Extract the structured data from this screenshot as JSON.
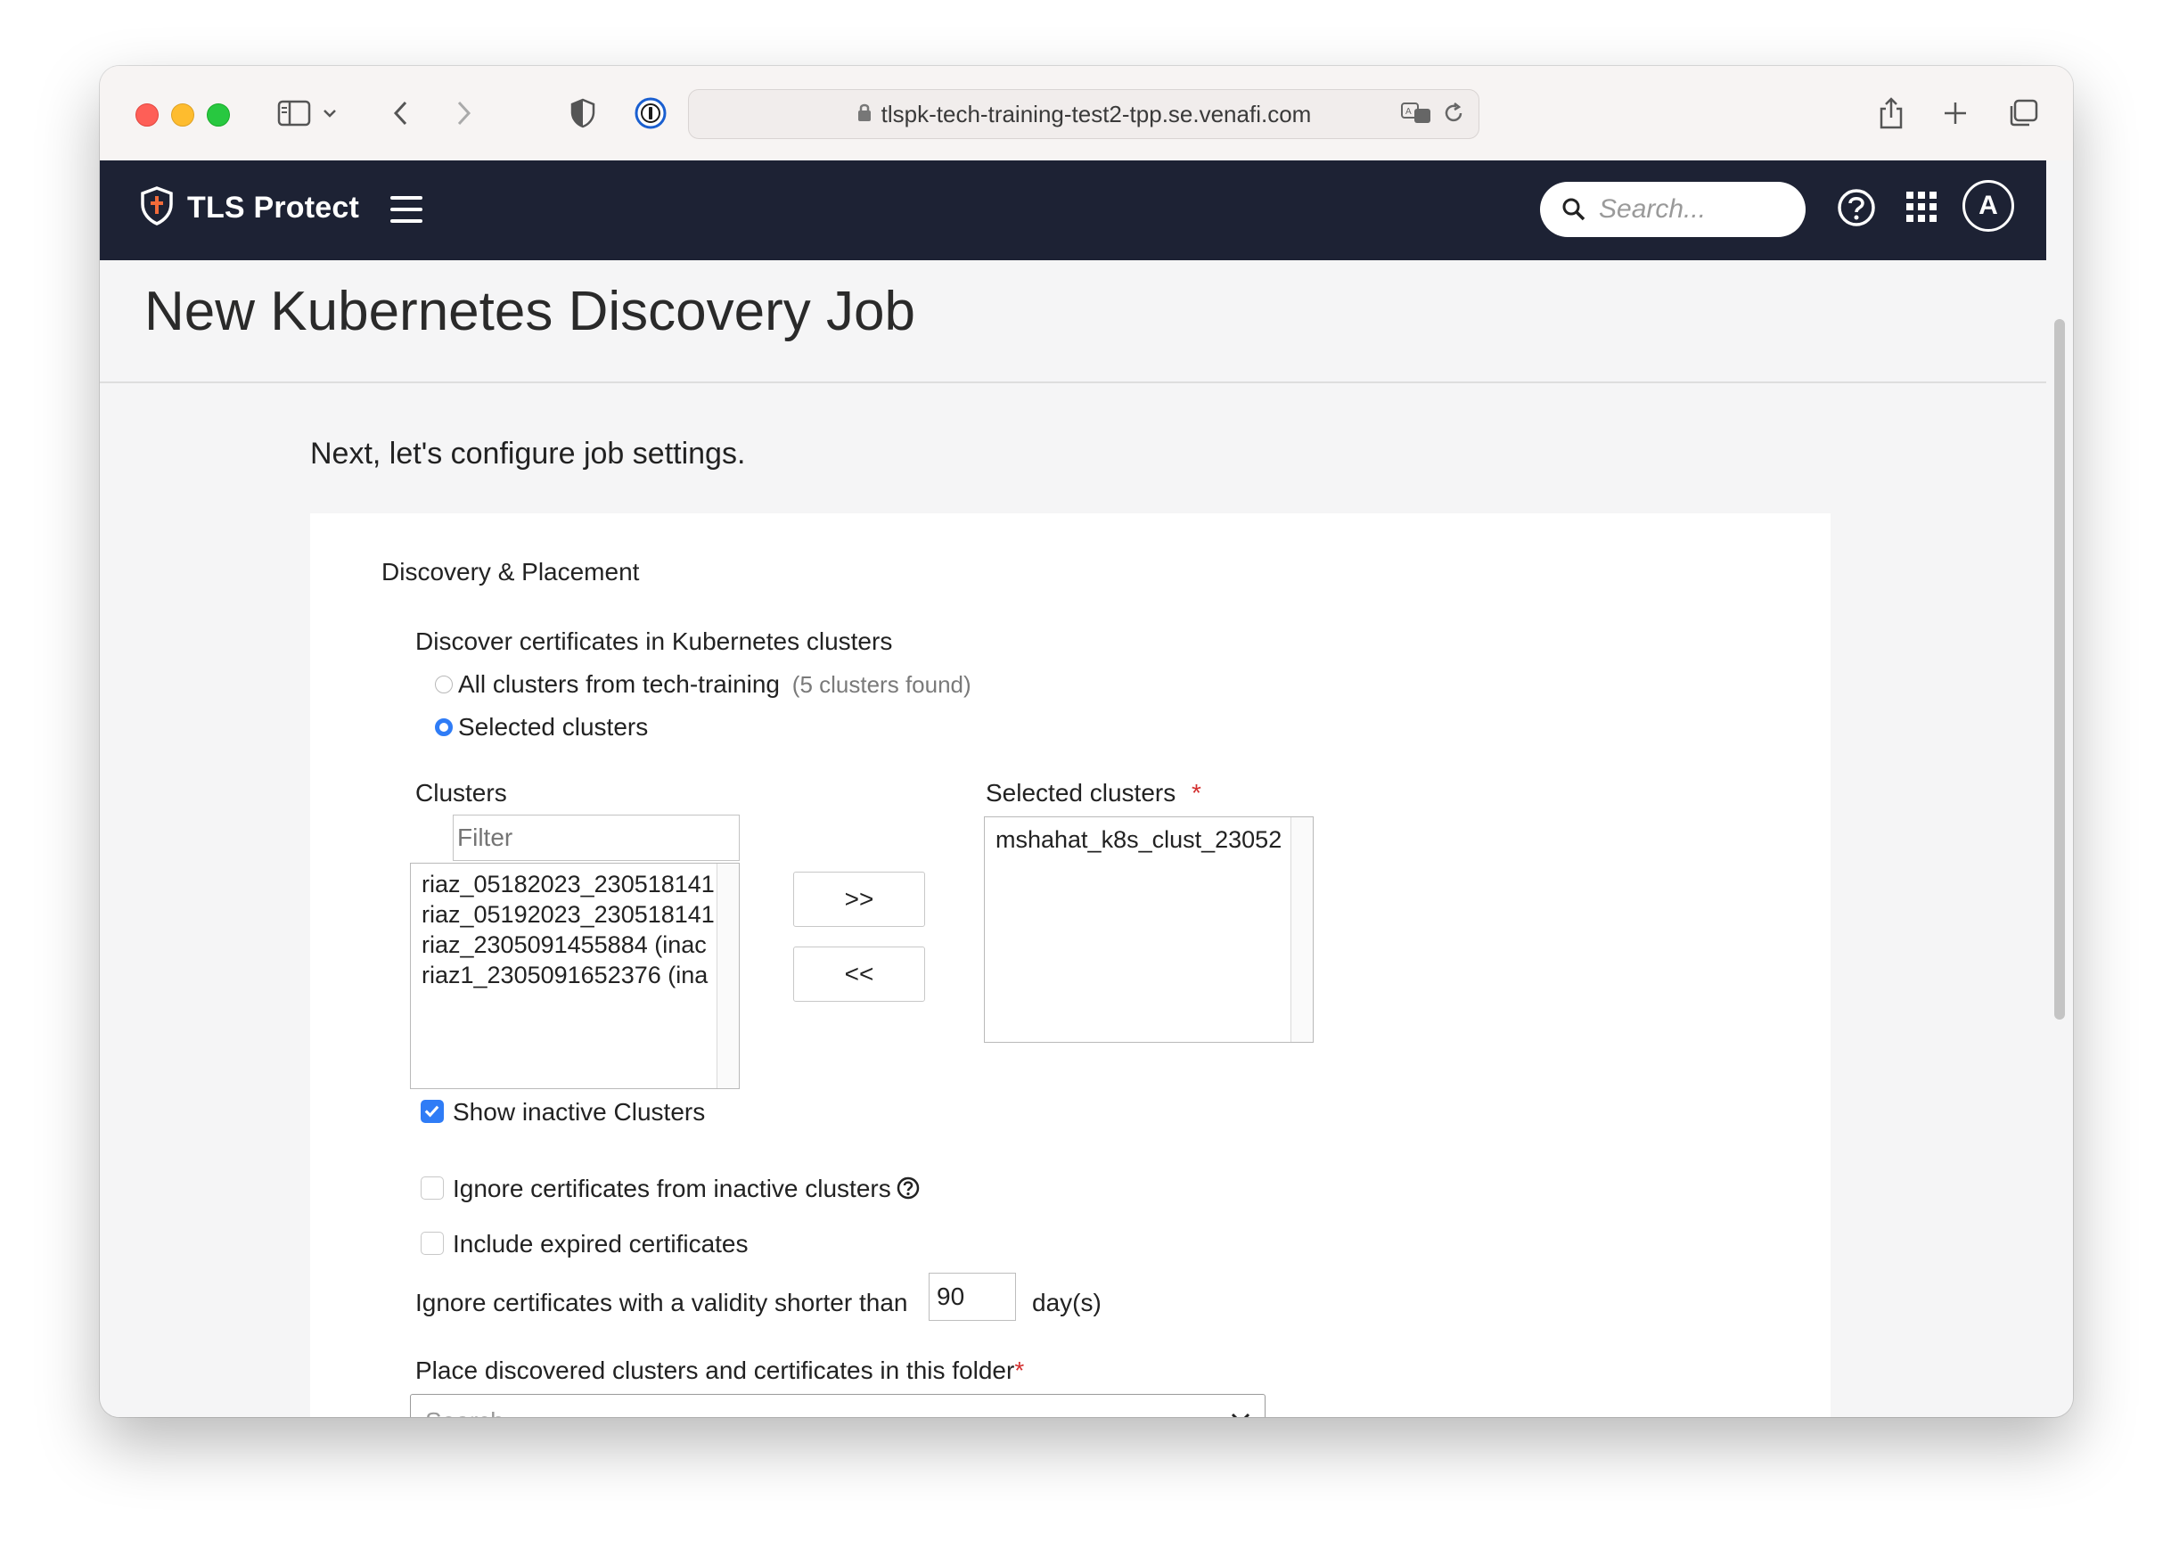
{
  "browser": {
    "url": "tlspk-tech-training-test2-tpp.se.venafi.com"
  },
  "header": {
    "brand": "TLS Protect",
    "search_placeholder": "Search...",
    "avatar_initial": "A"
  },
  "page": {
    "title": "New Kubernetes Discovery Job",
    "subtitle": "Next, let's configure job settings."
  },
  "form": {
    "section_title": "Discovery & Placement",
    "discover_label": "Discover certificates in Kubernetes clusters",
    "radio_all_label": "All clusters from tech-training",
    "radio_all_note": "(5 clusters found)",
    "radio_selected_label": "Selected clusters",
    "selected_option": "Selected clusters",
    "clusters_label": "Clusters",
    "filter_placeholder": "Filter",
    "clusters": [
      "riaz_05182023_230518141",
      "riaz_05192023_230518141",
      "riaz_2305091455884 (inac",
      "riaz1_2305091652376 (ina"
    ],
    "add_button": ">>",
    "remove_button": "<<",
    "selected_clusters_label": "Selected clusters",
    "required_mark": "*",
    "selected_clusters": [
      "mshahat_k8s_clust_23052"
    ],
    "show_inactive_label": "Show inactive Clusters",
    "show_inactive_checked": true,
    "ignore_inactive_label": "Ignore certificates from inactive clusters",
    "ignore_inactive_checked": false,
    "include_expired_label": "Include expired certificates",
    "include_expired_checked": false,
    "validity_label": "Ignore certificates with a validity shorter than",
    "validity_value": "90",
    "validity_unit": "day(s)",
    "folder_label": "Place discovered clusters and certificates in this folder",
    "folder_placeholder": "Search"
  },
  "colors": {
    "header_bg": "#1d2234",
    "accent": "#2f7cf6",
    "required": "#d32f2f"
  }
}
